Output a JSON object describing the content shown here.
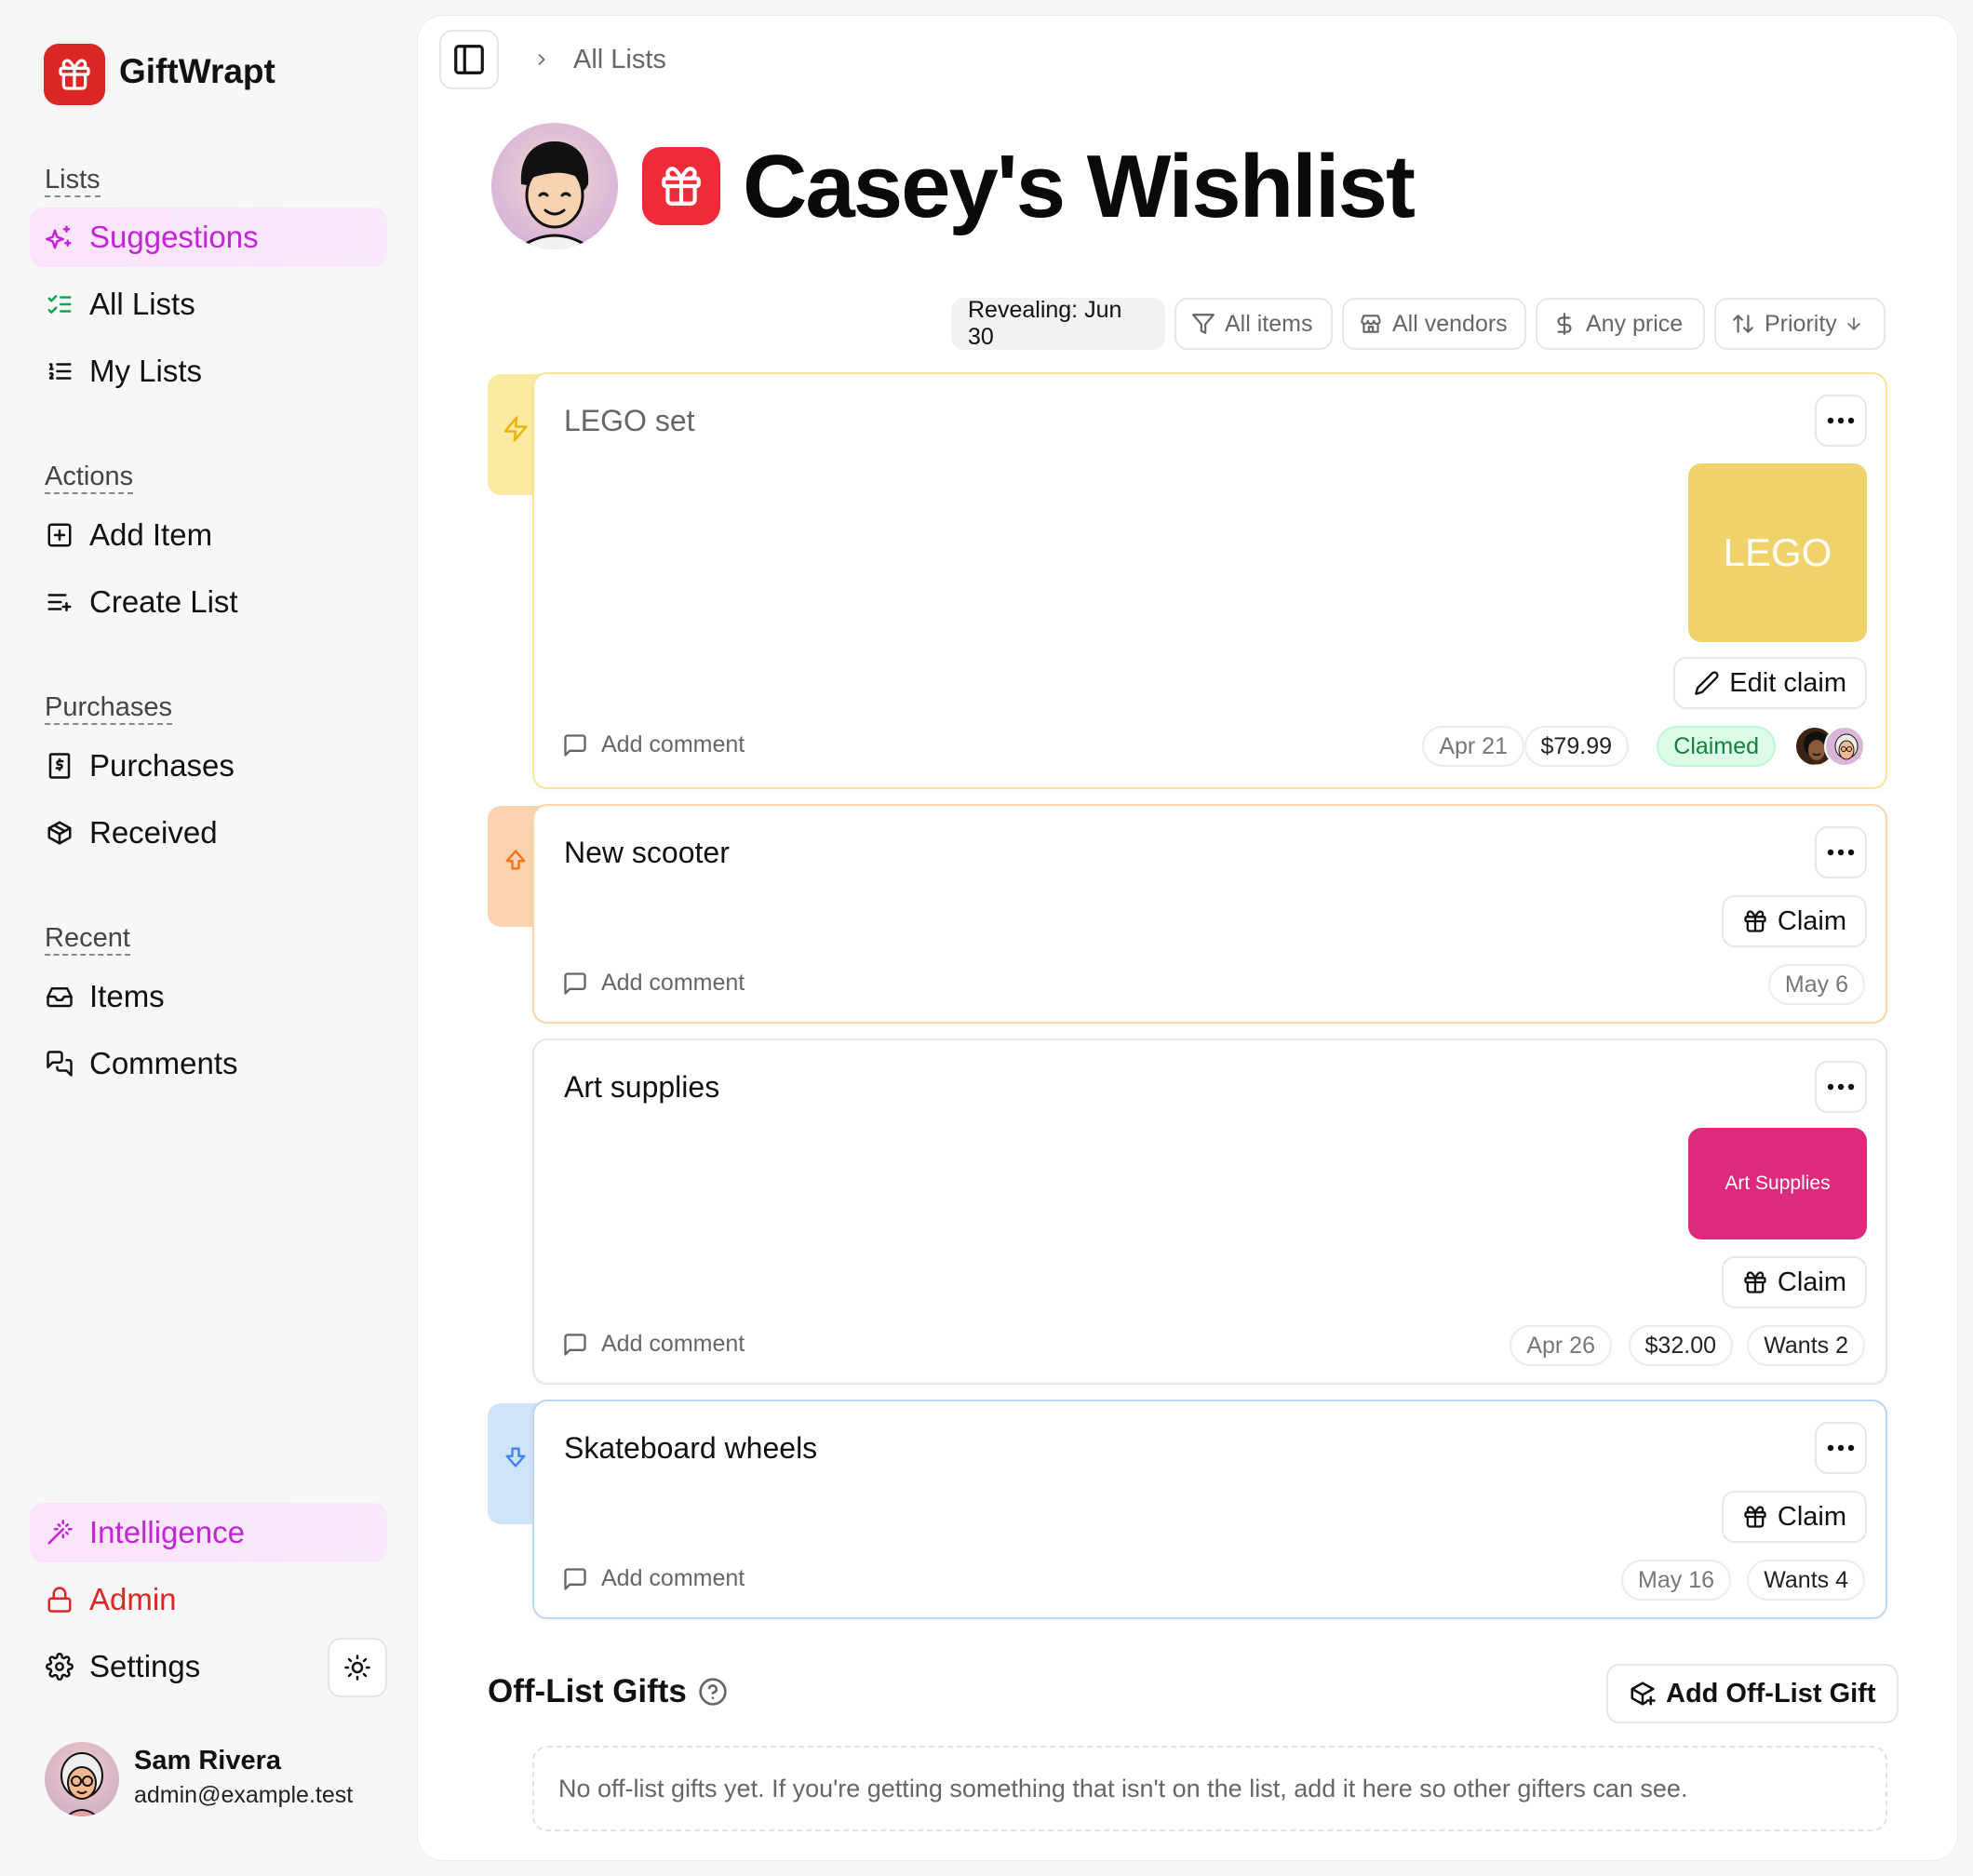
{
  "app": {
    "name": "GiftWrapt",
    "brand_color": "#dc2626",
    "accent_color": "#c026d3"
  },
  "sidebar": {
    "sections": {
      "lists": "Lists",
      "actions": "Actions",
      "purchases": "Purchases",
      "recent": "Recent"
    },
    "items": {
      "suggestions": {
        "label": "Suggestions",
        "icon": "sparkles-icon",
        "active": true
      },
      "all_lists": {
        "label": "All Lists",
        "icon": "list-checks-icon"
      },
      "my_lists": {
        "label": "My Lists",
        "icon": "list-ordered-icon"
      },
      "add_item": {
        "label": "Add Item",
        "icon": "square-plus-icon"
      },
      "create_list": {
        "label": "Create List",
        "icon": "list-plus-icon"
      },
      "purchases": {
        "label": "Purchases",
        "icon": "receipt-icon"
      },
      "received": {
        "label": "Received",
        "icon": "package-icon"
      },
      "items": {
        "label": "Items",
        "icon": "inbox-icon"
      },
      "comments": {
        "label": "Comments",
        "icon": "messages-icon"
      },
      "intelligence": {
        "label": "Intelligence",
        "icon": "wand-icon",
        "active": true
      },
      "admin": {
        "label": "Admin",
        "icon": "lock-icon",
        "color": "#dc2626"
      },
      "settings": {
        "label": "Settings",
        "icon": "gear-icon"
      }
    },
    "user": {
      "name": "Sam Rivera",
      "email": "admin@example.test"
    }
  },
  "header": {
    "breadcrumb": "All Lists"
  },
  "list": {
    "title": "Casey's Wishlist"
  },
  "filters": {
    "revealing": "Revealing: Jun 30",
    "items": "All items",
    "vendors": "All vendors",
    "price": "Any price",
    "sort": "Priority"
  },
  "items": [
    {
      "title": "LEGO set",
      "priority": "very-high",
      "priority_color": "#facc15",
      "thumbnail_text": "LEGO",
      "thumbnail_color": "#f0d26b",
      "action": "Edit claim",
      "comment": "Add comment",
      "date": "Apr 21",
      "price": "$79.99",
      "status": "Claimed"
    },
    {
      "title": "New scooter",
      "priority": "high",
      "priority_color": "#fb923c",
      "action": "Claim",
      "comment": "Add comment",
      "date": "May 6"
    },
    {
      "title": "Art supplies",
      "priority": "normal",
      "thumbnail_text": "Art Supplies",
      "thumbnail_color": "#de2a7c",
      "action": "Claim",
      "comment": "Add comment",
      "date": "Apr 26",
      "price": "$32.00",
      "wants": "Wants 2"
    },
    {
      "title": "Skateboard wheels",
      "priority": "low",
      "priority_color": "#60a5fa",
      "action": "Claim",
      "comment": "Add comment",
      "date": "May 16",
      "wants": "Wants 4"
    }
  ],
  "off_list": {
    "title": "Off-List Gifts",
    "add_button": "Add Off-List Gift",
    "empty_text": "No off-list gifts yet. If you're getting something that isn't on the list, add it here so other gifters can see."
  }
}
